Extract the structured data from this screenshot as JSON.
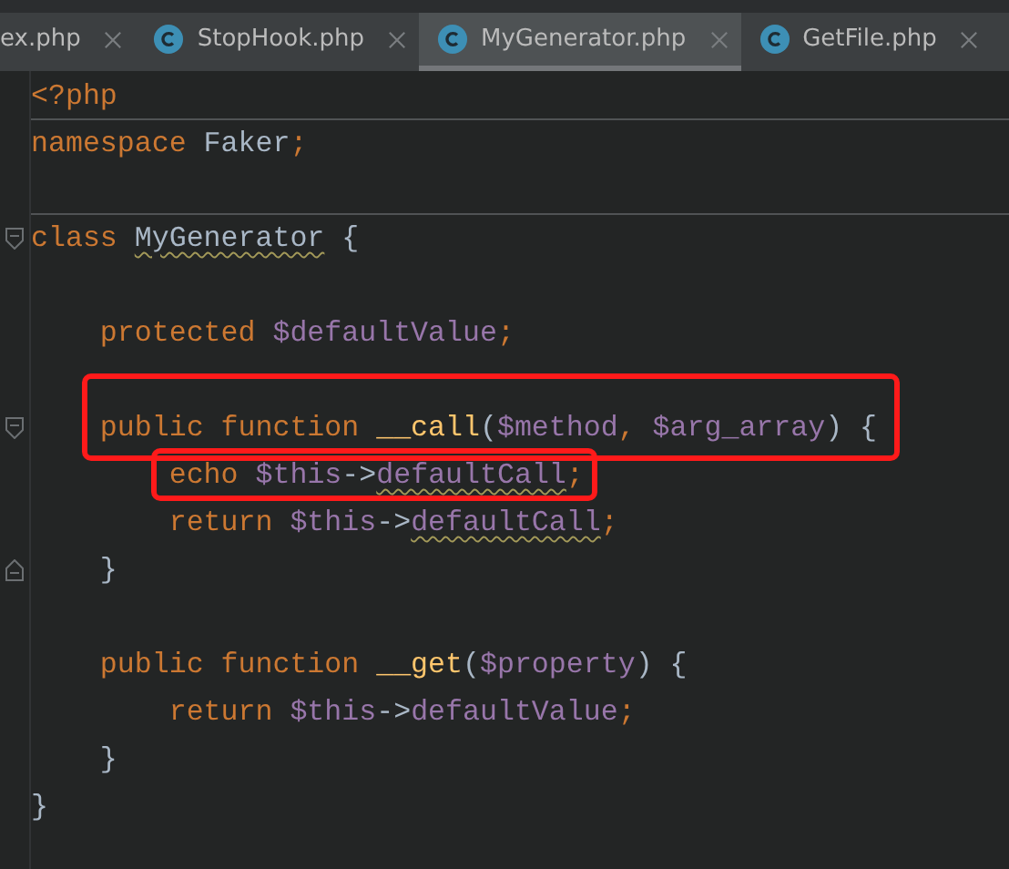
{
  "tabs": [
    {
      "label": "ex.php",
      "selected": false,
      "icon": false
    },
    {
      "label": "StopHook.php",
      "selected": false,
      "icon": true
    },
    {
      "label": "MyGenerator.php",
      "selected": true,
      "icon": true
    },
    {
      "label": "GetFile.php",
      "selected": false,
      "icon": true
    }
  ],
  "code": [
    {
      "kind": "code",
      "tokens": [
        {
          "kind": "tag",
          "text": "<?php"
        }
      ],
      "separator_after": true
    },
    {
      "kind": "code",
      "tokens": [
        {
          "kind": "keyword",
          "text": "namespace "
        },
        {
          "kind": "plain",
          "text": "Faker"
        },
        {
          "kind": "keyword",
          "text": ";"
        }
      ]
    },
    {
      "kind": "blank",
      "separator_after": true
    },
    {
      "kind": "code",
      "fold_start": true,
      "tokens": [
        {
          "kind": "keyword",
          "text": "class "
        },
        {
          "kind": "plain",
          "text": "MyGenerator",
          "warning": true
        },
        {
          "kind": "plain",
          "text": " {"
        }
      ]
    },
    {
      "kind": "blank"
    },
    {
      "kind": "code",
      "tokens": [
        {
          "kind": "keyword",
          "text": "    protected "
        },
        {
          "kind": "var",
          "text": "$defaultValue"
        },
        {
          "kind": "keyword",
          "text": ";"
        }
      ]
    },
    {
      "kind": "blank"
    },
    {
      "kind": "code",
      "fold_start": true,
      "highlight": true,
      "tokens": [
        {
          "kind": "keyword",
          "text": "    public function "
        },
        {
          "kind": "func",
          "text": "__call"
        },
        {
          "kind": "plain",
          "text": "("
        },
        {
          "kind": "var",
          "text": "$method"
        },
        {
          "kind": "keyword",
          "text": ", "
        },
        {
          "kind": "var",
          "text": "$arg_array"
        },
        {
          "kind": "plain",
          "text": ") {"
        }
      ]
    },
    {
      "kind": "code",
      "highlight": true,
      "tokens": [
        {
          "kind": "keyword",
          "text": "        echo "
        },
        {
          "kind": "var",
          "text": "$this"
        },
        {
          "kind": "plain",
          "text": "->"
        },
        {
          "kind": "var",
          "text": "defaultCall",
          "warning": true
        },
        {
          "kind": "keyword",
          "text": ";"
        }
      ]
    },
    {
      "kind": "code",
      "tokens": [
        {
          "kind": "keyword",
          "text": "        return "
        },
        {
          "kind": "var",
          "text": "$this"
        },
        {
          "kind": "plain",
          "text": "->"
        },
        {
          "kind": "var",
          "text": "defaultCall",
          "warning": true
        },
        {
          "kind": "keyword",
          "text": ";"
        }
      ]
    },
    {
      "kind": "code",
      "fold_end": true,
      "tokens": [
        {
          "kind": "plain",
          "text": "    }"
        }
      ]
    },
    {
      "kind": "blank"
    },
    {
      "kind": "code",
      "tokens": [
        {
          "kind": "keyword",
          "text": "    public function "
        },
        {
          "kind": "func",
          "text": "__get"
        },
        {
          "kind": "plain",
          "text": "("
        },
        {
          "kind": "var",
          "text": "$property"
        },
        {
          "kind": "plain",
          "text": ") {"
        }
      ]
    },
    {
      "kind": "code",
      "tokens": [
        {
          "kind": "keyword",
          "text": "        return "
        },
        {
          "kind": "var",
          "text": "$this"
        },
        {
          "kind": "plain",
          "text": "->"
        },
        {
          "kind": "var",
          "text": "defaultValue"
        },
        {
          "kind": "keyword",
          "text": ";"
        }
      ]
    },
    {
      "kind": "code",
      "tokens": [
        {
          "kind": "plain",
          "text": "    }"
        }
      ]
    },
    {
      "kind": "code",
      "tokens": [
        {
          "kind": "plain",
          "text": "}"
        }
      ]
    }
  ]
}
